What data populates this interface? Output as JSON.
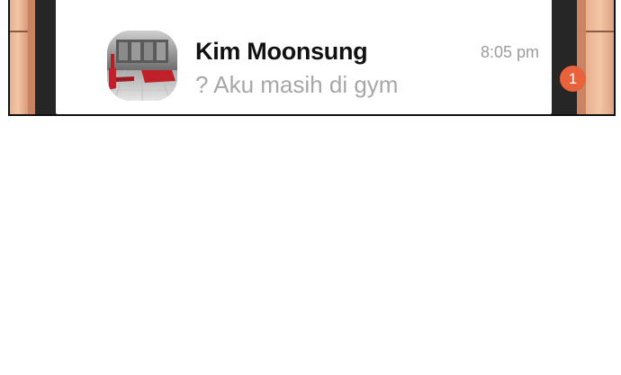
{
  "notification": {
    "sender_name": "Kim Moonsung",
    "message_preview": "? Aku masih di gym",
    "time": "8:05 pm",
    "unread_count": "1",
    "avatar_icon": "gym-photo-avatar",
    "badge_color": "#e8633b"
  }
}
